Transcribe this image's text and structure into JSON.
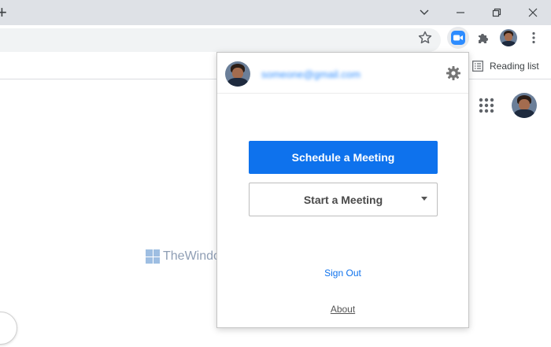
{
  "titlebar": {
    "new_tab_glyph": "+",
    "controls": [
      "chevron-down-icon",
      "minimize-icon",
      "restore-icon",
      "close-icon"
    ]
  },
  "toolbar": {
    "icons": [
      "star-icon",
      "zoom-camera-icon",
      "puzzle-icon",
      "profile-avatar",
      "kebab-menu-icon"
    ]
  },
  "bookmarks": {
    "reading_list_label": "Reading list"
  },
  "page": {
    "watermark_text": "TheWindowsClub"
  },
  "popup": {
    "email": "someone@gmail.com",
    "schedule_label": "Schedule a Meeting",
    "start_label": "Start a Meeting",
    "sign_out_label": "Sign Out",
    "about_label": "About"
  },
  "colors": {
    "zoom_blue": "#0e72ed",
    "tab_strip": "#dee1e6",
    "omnibox": "#f1f3f4"
  }
}
